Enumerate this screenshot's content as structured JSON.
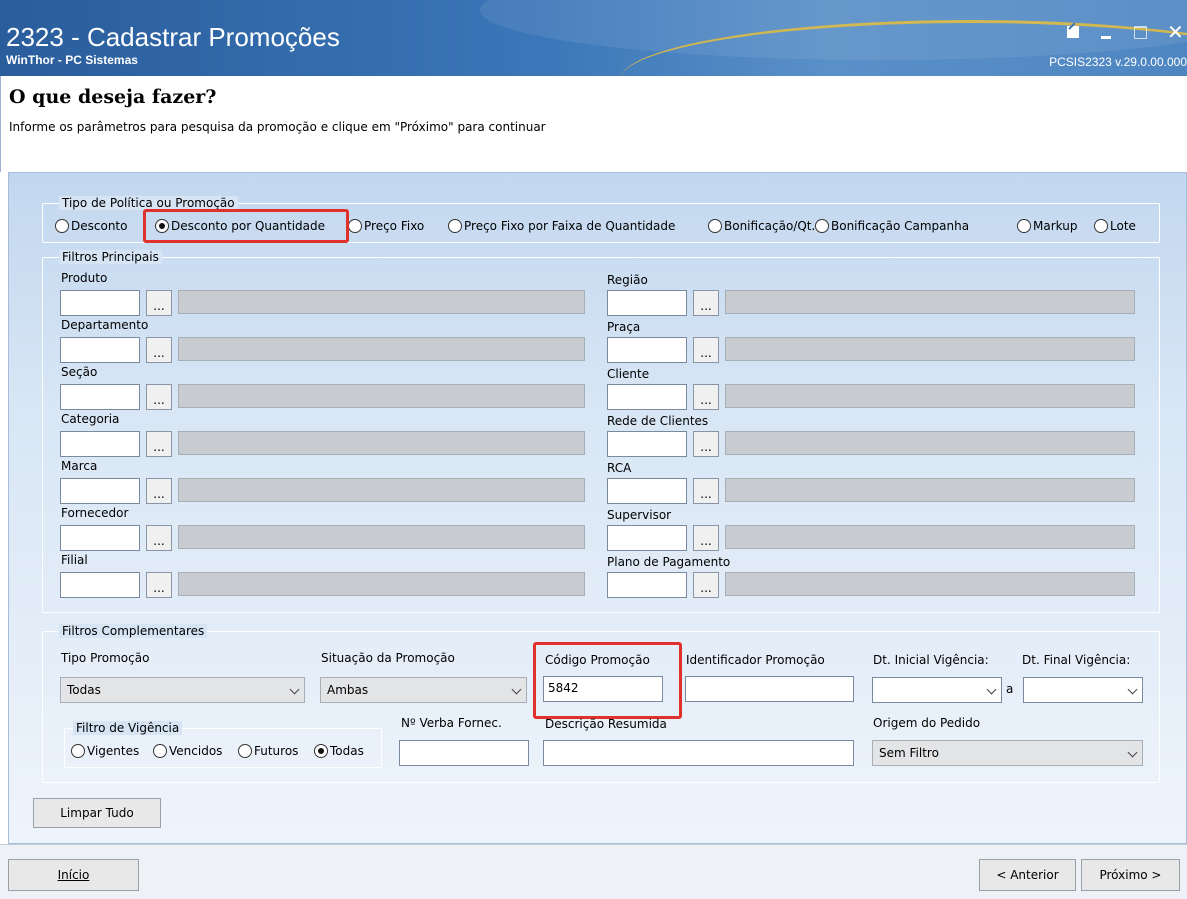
{
  "window": {
    "title": "2323 - Cadastrar Promoções",
    "subtitle": "WinThor - PC Sistemas",
    "version": "PCSIS2323  v.29.0.00.000"
  },
  "header": {
    "heading": "O que deseja fazer?",
    "description": "Informe os parâmetros para pesquisa da promoção e clique em \"Próximo\" para continuar"
  },
  "tipo_politica": {
    "title": "Tipo de Política ou Promoção",
    "options": [
      "Desconto",
      "Desconto por Quantidade",
      "Preço Fixo",
      "Preço Fixo por Faixa de Quantidade",
      "Bonificação/Qt.",
      "Bonificação Campanha",
      "Markup",
      "Lote"
    ],
    "selected": "Desconto por Quantidade"
  },
  "filtros_principais": {
    "title": "Filtros Principais",
    "left": [
      "Produto",
      "Departamento",
      "Seção",
      "Categoria",
      "Marca",
      "Fornecedor",
      "Filial"
    ],
    "right": [
      "Região",
      "Praça",
      "Cliente",
      "Rede de Clientes",
      "RCA",
      "Supervisor",
      "Plano de Pagamento"
    ],
    "button_label": "..."
  },
  "filtros_complementares": {
    "title": "Filtros Complementares",
    "tipo_promocao": {
      "label": "Tipo Promoção",
      "value": "Todas"
    },
    "situacao": {
      "label": "Situação da Promoção",
      "value": "Ambas"
    },
    "codigo": {
      "label": "Código Promoção",
      "value": "5842"
    },
    "identificador": {
      "label": "Identificador Promoção",
      "value": ""
    },
    "dt_inicial": {
      "label": "Dt. Inicial Vigência:",
      "value": ""
    },
    "dt_separator": "a",
    "dt_final": {
      "label": "Dt. Final Vigência:",
      "value": ""
    },
    "vigencia": {
      "title": "Filtro de Vigência",
      "options": [
        "Vigentes",
        "Vencidos",
        "Futuros",
        "Todas"
      ],
      "selected": "Todas"
    },
    "verba": {
      "label": "Nº Verba Fornec.",
      "value": ""
    },
    "descricao": {
      "label": "Descrição Resumida",
      "value": ""
    },
    "origem": {
      "label": "Origem do Pedido",
      "value": "Sem Filtro"
    }
  },
  "buttons": {
    "limpar": "Limpar Tudo",
    "inicio": "Início",
    "anterior": "< Anterior",
    "proximo": "Próximo >"
  },
  "colors": {
    "highlight": "#e0312c",
    "titlebar": "#3a76b8"
  }
}
